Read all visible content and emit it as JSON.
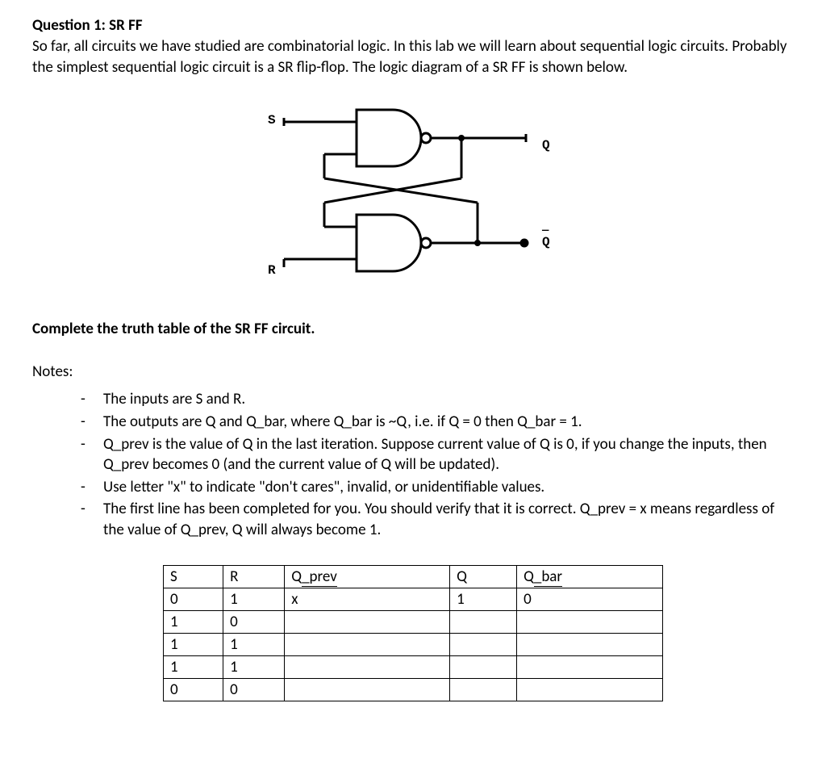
{
  "heading": "Question 1: SR FF",
  "intro": "So far, all circuits we have studied are combinatorial logic. In this lab we will learn about sequential logic circuits. Probably the simplest sequential logic circuit is a SR flip-flop. The logic diagram of a SR FF is shown below.",
  "task": "Complete the truth table of the SR FF circuit.",
  "notes_title": "Notes:",
  "notes": [
    "The inputs are S and R.",
    "The outputs are Q and Q_bar, where Q_bar is ~Q, i.e. if Q = 0 then Q_bar = 1.",
    "Q_prev is the value of Q in the last iteration. Suppose current value of Q is 0, if you change the inputs, then Q_prev becomes 0 (and the current value of Q will be updated).",
    "Use letter \"x\" to indicate \"don't cares\", invalid, or unidentifiable values.",
    "The first line has been completed for you. You should verify that it is correct. Q_prev = x means regardless of the value of Q_prev, Q will always become 1."
  ],
  "diagram_labels": {
    "S": "S",
    "R": "R",
    "Q": "Q",
    "Qbar_overline": "—",
    "Qbar": "Q"
  },
  "chart_data": {
    "type": "table",
    "headers": [
      "S",
      "R",
      "Q_prev",
      "Q",
      "Q_bar"
    ],
    "rows": [
      [
        "0",
        "1",
        "x",
        "1",
        "0"
      ],
      [
        "1",
        "0",
        "",
        "",
        ""
      ],
      [
        "1",
        "1",
        "",
        "",
        ""
      ],
      [
        "1",
        "1",
        "",
        "",
        ""
      ],
      [
        "0",
        "0",
        "",
        "",
        ""
      ]
    ]
  }
}
